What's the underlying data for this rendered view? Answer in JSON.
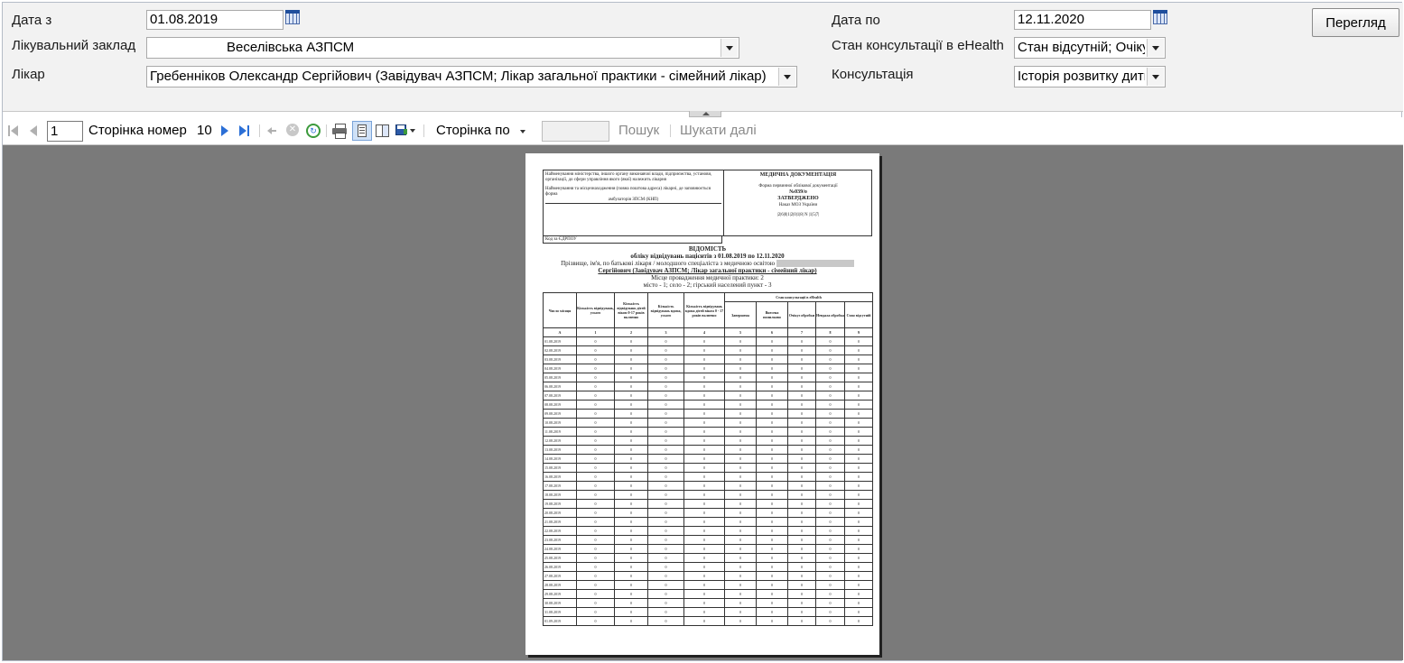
{
  "params": {
    "date_from_label": "Дата з",
    "date_from_value": "01.08.2019",
    "facility_label": "Лікувальний заклад",
    "facility_value": "Веселівська АЗПСМ",
    "doctor_label": "Лікар",
    "doctor_value": "Гребенніков Олександр Сергійович (Завідувач АЗПСМ; Лікар загальної практики - сімейний лікар)",
    "date_to_label": "Дата по",
    "date_to_value": "12.11.2020",
    "ehealth_status_label": "Стан консультації в eHealth",
    "ehealth_status_value": "Стан відсутній; Очікує",
    "consultation_label": "Консультація",
    "consultation_value": "Історія розвитку дити",
    "view_button": "Перегляд"
  },
  "toolbar": {
    "page_number": "1",
    "page_label": "Сторінка номер",
    "page_total": "10",
    "page_width": "Сторінка по",
    "find": "Пошук",
    "find_next": "Шукати далі"
  },
  "report": {
    "header_left": "Найменування міністерства, іншого органу виконавчої влади, підприємства, установи, організації, до сфери управління якого (якої) належить лікарня",
    "header_left2": "Найменування та місцезнаходження (повна поштова адреса) лікарні, де заповнюється форма",
    "header_left3": "амбулаторія ЗПСМ (КНП)",
    "edrpou": "Код за ЄДРПОУ",
    "header_right_title": "МЕДИЧНА ДОКУМЕНТАЦІЯ",
    "header_right_form": "Форма первинної облікової документації",
    "header_right_num": "№039/о",
    "header_right_approved": "ЗАТВЕРДЖЕНО",
    "header_right_order": "Наказ МОЗ України",
    "header_right_code": "|2|6|0|1|2|0|1|8| N |1|5|7|",
    "title": "ВІДОМІСТЬ",
    "subtitle": "обліку відвідувань пацієнтів з 01.08.2019 по 12.11.2020",
    "doctor_line": "Прізвище, ім'я, по батькові лікаря / молодшого спеціаліста з медичною освітою",
    "doctor_line2": "Сергійович (Завідувач АЗПСМ; Лікар загальної практики - сімейний лікар)",
    "place_line": "Місце провадження медичної практики: 2",
    "place_legend": "місто - 1; село - 2; гірський населений пункт - 3",
    "columns": [
      "Число місяця",
      "Кількість відвідувань, усього",
      "Кількість відвідувань дітей віком 0-17 років включно",
      "Кількість відвідувань вдома, усього",
      "Кількість відвідувань вдома дітей віком 0 - 17 років включно",
      "Завершена",
      "Внесена помилково",
      "Очікує обробки",
      "Невдала обробка",
      "Стан відсутній"
    ],
    "ehealth_header": "Стан консультації в eHealth",
    "col_numbers": [
      "А",
      "1",
      "2",
      "3",
      "4",
      "5",
      "6",
      "7",
      "8",
      "9"
    ],
    "rows": [
      "01.08.2019",
      "02.08.2019",
      "03.08.2019",
      "04.08.2019",
      "05.08.2019",
      "06.08.2019",
      "07.08.2019",
      "08.08.2019",
      "09.08.2019",
      "10.08.2019",
      "11.08.2019",
      "12.08.2019",
      "13.08.2019",
      "14.08.2019",
      "15.08.2019",
      "16.08.2019",
      "17.08.2019",
      "18.08.2019",
      "19.08.2019",
      "20.08.2019",
      "21.08.2019",
      "22.08.2019",
      "23.08.2019",
      "24.08.2019",
      "25.08.2019",
      "26.08.2019",
      "27.08.2019",
      "28.08.2019",
      "29.08.2019",
      "30.08.2019",
      "31.08.2019",
      "01.09.2019"
    ],
    "zero": "0"
  }
}
